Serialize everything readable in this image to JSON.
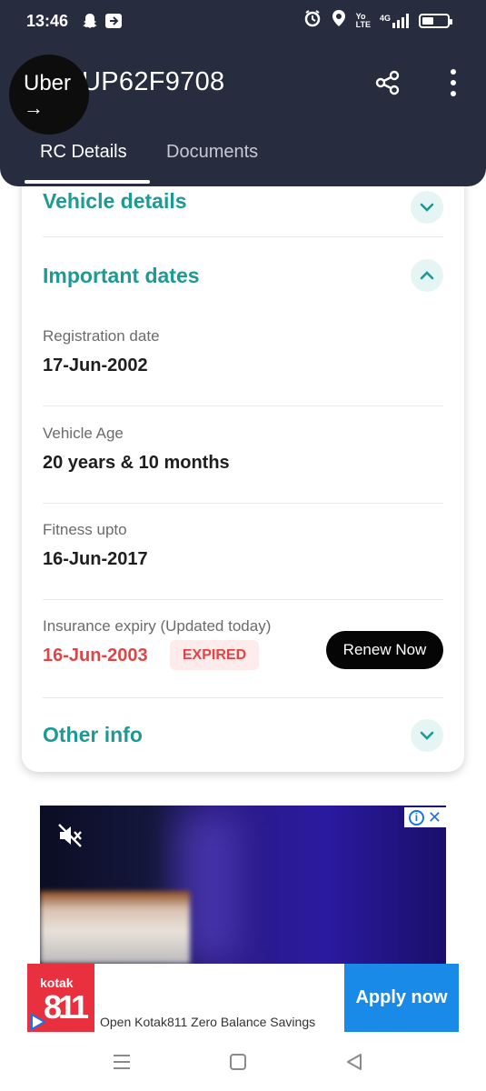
{
  "status_bar": {
    "time": "13:46",
    "network": "4G",
    "battery_level": 0.45
  },
  "header": {
    "bubble_logo": "Uber",
    "bubble_arrow": "→",
    "title": "UP62F9708",
    "tabs": [
      {
        "label": "RC Details",
        "active": true
      },
      {
        "label": "Documents",
        "active": false
      }
    ]
  },
  "card": {
    "vehicle_details_title": "Vehicle details",
    "important_dates_title": "Important dates",
    "fields": [
      {
        "label": "Registration date",
        "value": "17-Jun-2002"
      },
      {
        "label": "Vehicle Age",
        "value": "20 years & 10 months"
      },
      {
        "label": "Fitness upto",
        "value": "16-Jun-2017"
      },
      {
        "label": "Insurance expiry (Updated today)",
        "value": "16-Jun-2003"
      }
    ],
    "expired_badge": "EXPIRED",
    "renew_button": "Renew Now",
    "other_info_title": "Other info"
  },
  "ad": {
    "brand_name": "kotak",
    "brand_mark": "811",
    "text": "Open Kotak811 Zero Balance Savings",
    "cta": "Apply now",
    "adchoices_info": "i",
    "adchoices_close": "✕"
  },
  "colors": {
    "header_bg": "#272d3f",
    "accent_teal": "#1d9a93",
    "danger_red": "#e14444",
    "cta_blue": "#1a8ae8",
    "brand_red": "#e8303e"
  }
}
